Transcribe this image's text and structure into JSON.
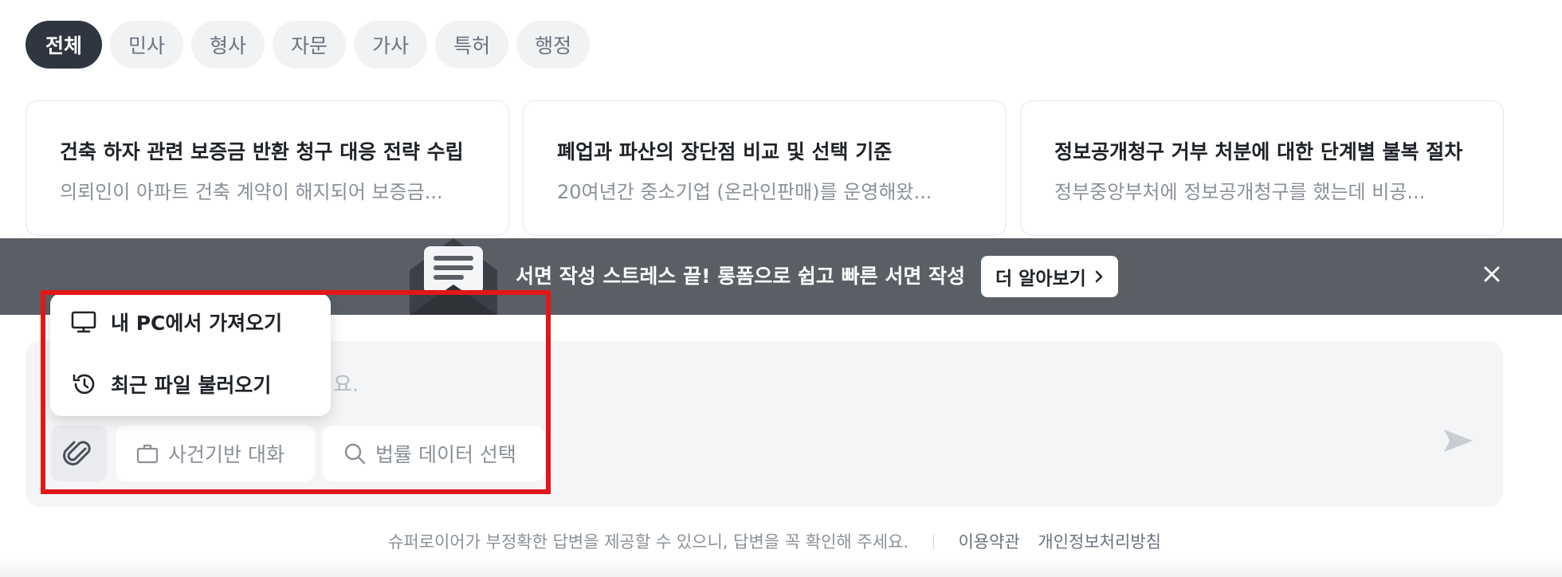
{
  "tabs": [
    {
      "label": "전체",
      "active": true
    },
    {
      "label": "민사",
      "active": false
    },
    {
      "label": "형사",
      "active": false
    },
    {
      "label": "자문",
      "active": false
    },
    {
      "label": "가사",
      "active": false
    },
    {
      "label": "특허",
      "active": false
    },
    {
      "label": "행정",
      "active": false
    }
  ],
  "cards": [
    {
      "title": "건축 하자 관련 보증금 반환 청구 대응 전략 수립",
      "preview": "의뢰인이 아파트 건축 계약이 해지되어 보증금..."
    },
    {
      "title": "폐업과 파산의 장단점 비교 및 선택 기준",
      "preview": "20여년간 중소기업 (온라인판매)를 운영해왔..."
    },
    {
      "title": "정보공개청구 거부 처분에 대한 단계별 불복 절차",
      "preview": "정부중앙부처에 정보공개청구를 했는데 비공..."
    }
  ],
  "banner": {
    "text": "서면 작성 스트레스 끝! 롱폼으로 쉽고 빠른 서면 작성",
    "button_label": "더 알아보기",
    "close_icon": "close-icon"
  },
  "composer": {
    "placeholder_visible": "요.",
    "chips": [
      {
        "label": "사건기반 대화",
        "icon": "briefcase-icon"
      },
      {
        "label": "법률 데이터 선택",
        "icon": "search-icon"
      }
    ]
  },
  "attach_menu": {
    "items": [
      {
        "label": "내 PC에서 가져오기",
        "icon": "monitor-icon"
      },
      {
        "label": "최근 파일 불러오기",
        "icon": "history-icon"
      }
    ]
  },
  "footer": {
    "disclaimer": "슈퍼로이어가 부정확한 답변을 제공할 수 있으니, 답변을 꼭 확인해 주세요.",
    "terms": "이용약관",
    "privacy": "개인정보처리방침"
  },
  "colors": {
    "active_tab": "#2f3641",
    "banner_bg": "#5a5f66",
    "highlight": "#e01818",
    "composer_bg": "#f4f5f7"
  }
}
